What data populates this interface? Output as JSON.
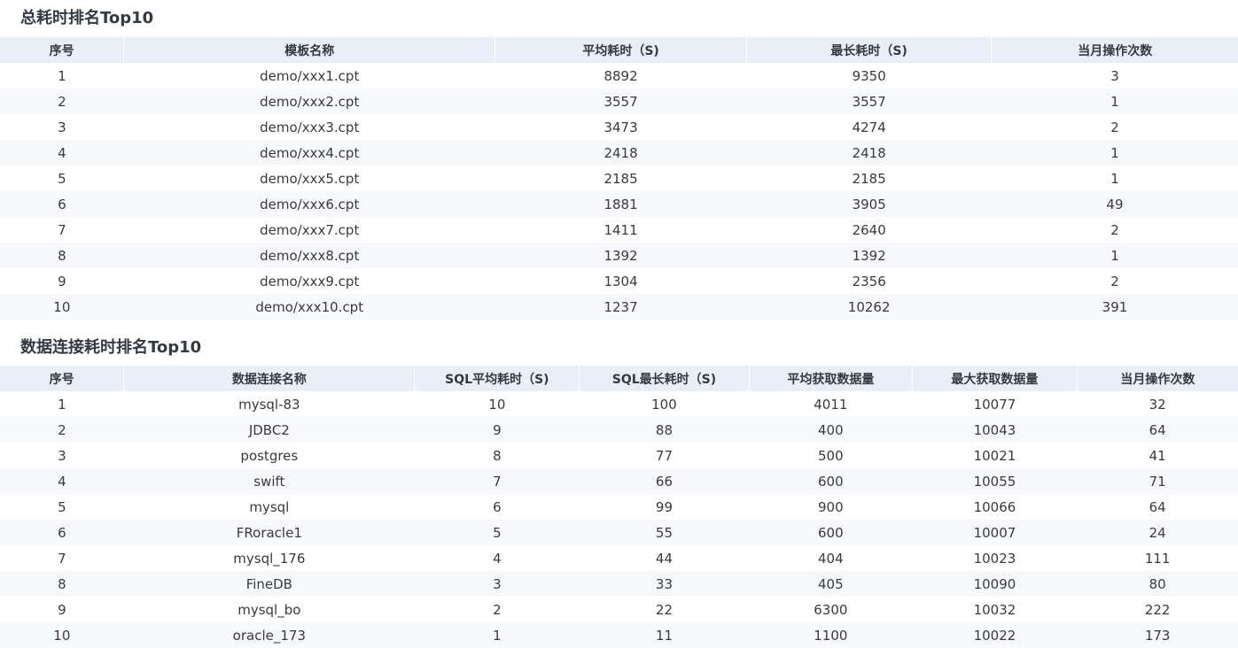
{
  "table1": {
    "title": "总耗时排名Top10",
    "columns": [
      "序号",
      "模板名称",
      "平均耗时（S)",
      "最长耗时（S)",
      "当月操作次数"
    ],
    "rows": [
      [
        "1",
        "demo/xxx1.cpt",
        "8892",
        "9350",
        "3"
      ],
      [
        "2",
        "demo/xxx2.cpt",
        "3557",
        "3557",
        "1"
      ],
      [
        "3",
        "demo/xxx3.cpt",
        "3473",
        "4274",
        "2"
      ],
      [
        "4",
        "demo/xxx4.cpt",
        "2418",
        "2418",
        "1"
      ],
      [
        "5",
        "demo/xxx5.cpt",
        "2185",
        "2185",
        "1"
      ],
      [
        "6",
        "demo/xxx6.cpt",
        "1881",
        "3905",
        "49"
      ],
      [
        "7",
        "demo/xxx7.cpt",
        "1411",
        "2640",
        "2"
      ],
      [
        "8",
        "demo/xxx8.cpt",
        "1392",
        "1392",
        "1"
      ],
      [
        "9",
        "demo/xxx9.cpt",
        "1304",
        "2356",
        "2"
      ],
      [
        "10",
        "demo/xxx10.cpt",
        "1237",
        "10262",
        "391"
      ]
    ]
  },
  "table2": {
    "title": "数据连接耗时排名Top10",
    "columns": [
      "序号",
      "数据连接名称",
      "SQL平均耗时（S)",
      "SQL最长耗时（S)",
      "平均获取数据量",
      "最大获取数据量",
      "当月操作次数"
    ],
    "rows": [
      [
        "1",
        "mysql-83",
        "10",
        "100",
        "4011",
        "10077",
        "32"
      ],
      [
        "2",
        "JDBC2",
        "9",
        "88",
        "400",
        "10043",
        "64"
      ],
      [
        "3",
        "postgres",
        "8",
        "77",
        "500",
        "10021",
        "41"
      ],
      [
        "4",
        "swift",
        "7",
        "66",
        "600",
        "10055",
        "71"
      ],
      [
        "5",
        "mysql",
        "6",
        "99",
        "900",
        "10066",
        "64"
      ],
      [
        "6",
        "FRoracle1",
        "5",
        "55",
        "600",
        "10007",
        "24"
      ],
      [
        "7",
        "mysql_176",
        "4",
        "44",
        "404",
        "10023",
        "111"
      ],
      [
        "8",
        "FineDB",
        "3",
        "33",
        "405",
        "10090",
        "80"
      ],
      [
        "9",
        "mysql_bo",
        "2",
        "22",
        "6300",
        "10032",
        "222"
      ],
      [
        "10",
        "oracle_173",
        "1",
        "11",
        "1100",
        "10022",
        "173"
      ]
    ]
  }
}
